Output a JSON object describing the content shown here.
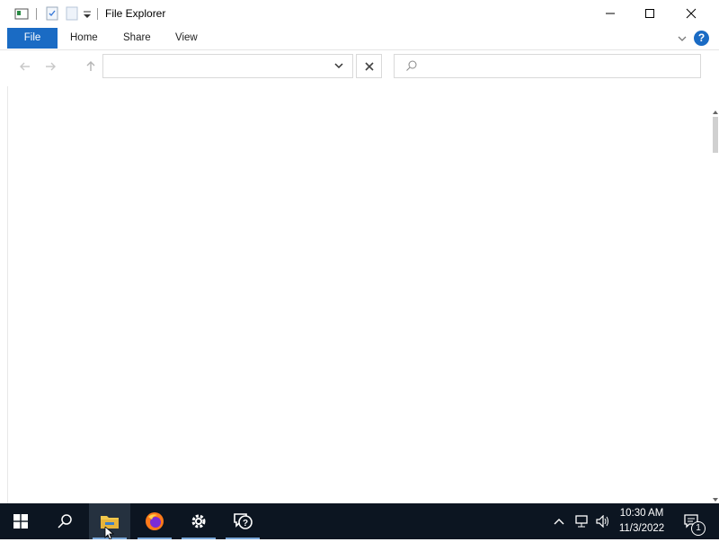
{
  "window": {
    "title": "File Explorer",
    "controls": {
      "minimize": "–",
      "maximize": "☐",
      "close": "✕"
    }
  },
  "ribbon": {
    "tabs": [
      {
        "label": "File",
        "active": true
      },
      {
        "label": "Home"
      },
      {
        "label": "Share"
      },
      {
        "label": "View"
      }
    ],
    "help_label": "?"
  },
  "address_bar": {
    "value": "",
    "placeholder": ""
  },
  "search": {
    "value": "",
    "placeholder": ""
  },
  "taskbar": {
    "items": [
      "start",
      "search",
      "file-explorer",
      "firefox",
      "settings",
      "feedback-hub"
    ],
    "clock": {
      "time": "10:30 AM",
      "date": "11/3/2022"
    },
    "notification_count": "1"
  },
  "colors": {
    "accent": "#1a6bc4",
    "taskbar": "#0c1521",
    "help": "#1a6bc4"
  }
}
